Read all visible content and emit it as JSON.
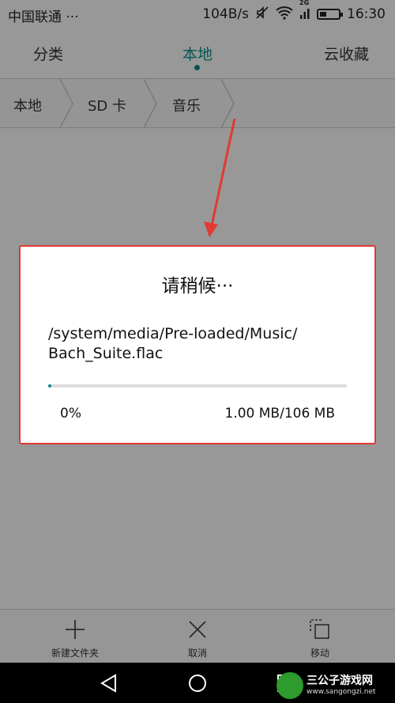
{
  "status": {
    "carrier": "中国联通 ···",
    "speed": "104B/s",
    "network": "2G",
    "battery_level": 0.35,
    "time": "16:30"
  },
  "tabs": [
    {
      "label": "分类",
      "active": false
    },
    {
      "label": "本地",
      "active": true
    },
    {
      "label": "云收藏",
      "active": false
    }
  ],
  "breadcrumb": [
    "本地",
    "SD 卡",
    "音乐"
  ],
  "dialog": {
    "title": "请稍候···",
    "path_line1": "/system/media/Pre-loaded/Music/",
    "path_line2": "Bach_Suite.flac",
    "progress": 0.0094,
    "percent": "0%",
    "size": "1.00 MB/106 MB"
  },
  "toolbar": {
    "new_folder": "新建文件夹",
    "cancel": "取消",
    "move": "移动"
  },
  "watermark": {
    "title": "三公子游戏网",
    "url": "www.sangongzi.net"
  },
  "colors": {
    "accent": "#0a8a8a",
    "highlight_border": "#e03a32"
  }
}
